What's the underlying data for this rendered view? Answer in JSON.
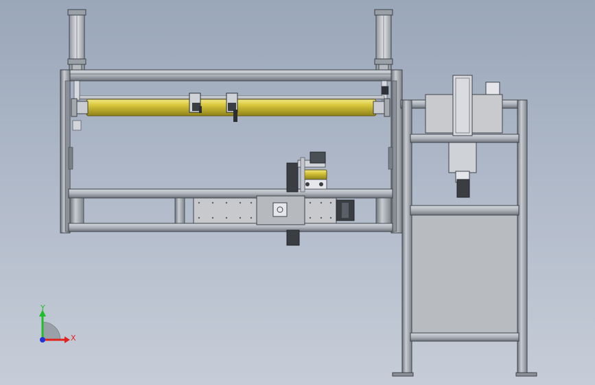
{
  "viewport": {
    "background_top": "#9aa7b9",
    "background_bottom": "#c6cdd8"
  },
  "colors": {
    "frame": "#b9bec6",
    "frame_dark": "#4a4e55",
    "roller": "#d8c63a",
    "roller_highlight": "#f3ea8a",
    "roller_shadow": "#8f8219",
    "panel": "#c7c9cc",
    "motor": "#3a3d42"
  },
  "triad": {
    "x_label": "X",
    "y_label": "Y",
    "x_color": "#e0241b",
    "y_color": "#1fbf2a",
    "z_color": "#2433d6"
  },
  "icons": {
    "triad": "coordinate-triad-icon"
  }
}
